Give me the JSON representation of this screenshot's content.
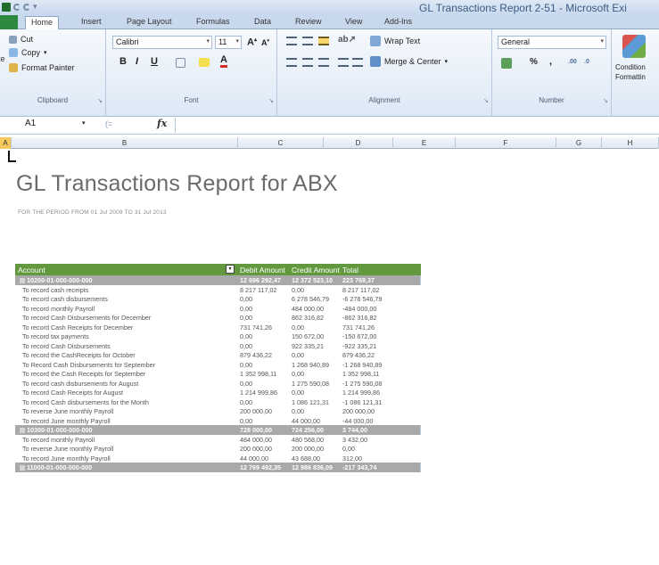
{
  "app": {
    "window_title": "GL Transactions Report 2-51 - Microsoft Exi"
  },
  "ribbon_tabs": [
    "Home",
    "Insert",
    "Page Layout",
    "Formulas",
    "Data",
    "Review",
    "View",
    "Add-Ins"
  ],
  "ribbon": {
    "clipboard": {
      "cut": "Cut",
      "copy": "Copy",
      "format_painter": "Format Painter",
      "group": "Clipboard",
      "paste_fragment": "te"
    },
    "font": {
      "name": "Calibri",
      "size": "11",
      "group": "Font",
      "bold": "B",
      "italic": "I",
      "underline": "U"
    },
    "alignment": {
      "wrap_text": "Wrap Text",
      "merge_center": "Merge & Center",
      "group": "Alignment"
    },
    "number": {
      "format": "General",
      "percent": "%",
      "comma": ",",
      "group": "Number"
    },
    "styles": {
      "conditional": "Condition",
      "formatting": "Formattin"
    }
  },
  "formula_bar": {
    "name_box": "A1",
    "fx": "fx",
    "value": ""
  },
  "columns": [
    "A",
    "B",
    "C",
    "D",
    "E",
    "F",
    "G",
    "H"
  ],
  "report": {
    "title": "GL Transactions Report for ABX",
    "period": "FOR THE PERIOD FROM 01 Jul 2009 TO 31 Jul 2013",
    "headers": {
      "account": "Account",
      "debit": "Debit Amount",
      "credit": "Credit Amount",
      "total": "Total"
    },
    "rows": [
      {
        "type": "group",
        "account": "10200-01-000-000-000",
        "debit": "12 696 292,47",
        "credit": "12 372 523,10",
        "total": "223 769,37"
      },
      {
        "type": "item",
        "account": "To record cash receipts",
        "debit": "8 217 117,02",
        "credit": "0,00",
        "total": "8 217 117,02"
      },
      {
        "type": "item",
        "account": "To record cash disbursements",
        "debit": "0,00",
        "credit": "6 278 546,79",
        "total": "-6 278 546,79"
      },
      {
        "type": "item",
        "account": "To record monthly Payroll",
        "debit": "0,00",
        "credit": "484 000,00",
        "total": "-484 000,00"
      },
      {
        "type": "item",
        "account": "To record Cash Disbursements  for December",
        "debit": "0,00",
        "credit": "862 316,82",
        "total": "-862 316,82"
      },
      {
        "type": "item",
        "account": "To record Cash Receipts for December",
        "debit": "731 741,26",
        "credit": "0,00",
        "total": "731 741,26"
      },
      {
        "type": "item",
        "account": "To record tax payments",
        "debit": "0,00",
        "credit": "150 672,00",
        "total": "-150 672,00"
      },
      {
        "type": "item",
        "account": "To record Cash Disbursements",
        "debit": "0,00",
        "credit": "922 335,21",
        "total": "-922 335,21"
      },
      {
        "type": "item",
        "account": "To record the CashReceipts for October",
        "debit": "879 436,22",
        "credit": "0,00",
        "total": "879 436,22"
      },
      {
        "type": "item",
        "account": "To Record Cash Disbursements for September",
        "debit": "0,00",
        "credit": "1 268 940,89",
        "total": "-1 268 940,89"
      },
      {
        "type": "item",
        "account": "To record the Cash Receipts for September",
        "debit": "1 352 998,11",
        "credit": "0,00",
        "total": "1 352 998,11"
      },
      {
        "type": "item",
        "account": "To record cash disbursements for August",
        "debit": "0,00",
        "credit": "1 275 590,08",
        "total": "-1 275 590,08"
      },
      {
        "type": "item",
        "account": "To record Cash Receipts for August",
        "debit": "1 214 999,86",
        "credit": "0,00",
        "total": "1 214 999,86"
      },
      {
        "type": "item",
        "account": "To record Cash disbursements for the Month",
        "debit": "0,00",
        "credit": "1 086 121,31",
        "total": "-1 086 121,31"
      },
      {
        "type": "item",
        "account": "To reverse June monthly Payroll",
        "debit": "200 000,00",
        "credit": "0,00",
        "total": "200 000,00"
      },
      {
        "type": "item",
        "account": "To record June monthly Payroll",
        "debit": "0,00",
        "credit": "44 000,00",
        "total": "-44 000,00"
      },
      {
        "type": "group",
        "account": "10300-01-000-000-000",
        "debit": "728 000,00",
        "credit": "724 256,00",
        "total": "3 744,00"
      },
      {
        "type": "item",
        "account": "To record monthly Payroll",
        "debit": "484 000,00",
        "credit": "480 568,00",
        "total": "3 432,00"
      },
      {
        "type": "item",
        "account": "To reverse June monthly Payroll",
        "debit": "200 000,00",
        "credit": "200 000,00",
        "total": "0,00"
      },
      {
        "type": "item",
        "account": "To record June monthly Payroll",
        "debit": "44 000,00",
        "credit": "43 688,00",
        "total": "312,00"
      },
      {
        "type": "group",
        "account": "11000-01-000-000-000",
        "debit": "12 769 492,35",
        "credit": "12 986 836,09",
        "total": "-217 343,74"
      }
    ]
  },
  "colors": {
    "header_green": "#62993e",
    "group_gray": "#a9a9a9",
    "office_blue": "#3b5a82"
  }
}
